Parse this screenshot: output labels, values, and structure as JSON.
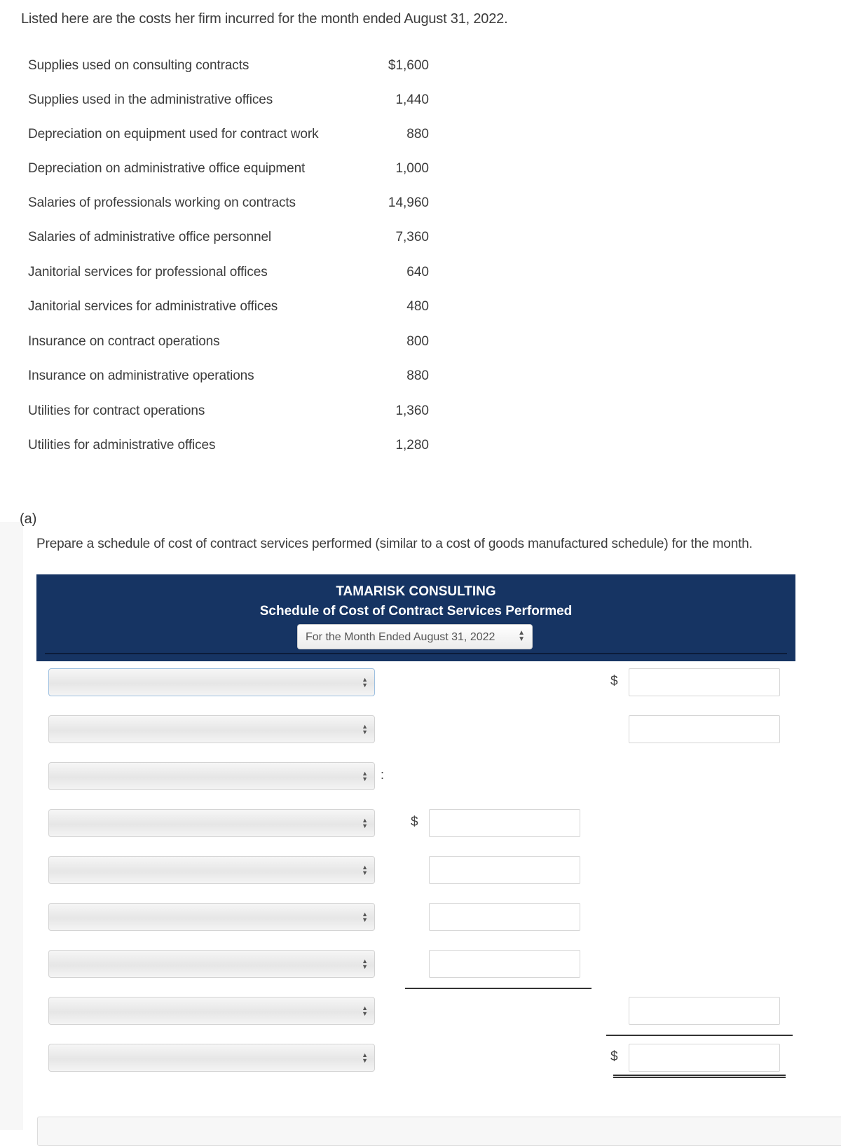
{
  "intro_text": "Listed here are the costs her firm incurred for the month ended August 31, 2022.",
  "costs": [
    {
      "label": "Supplies used on consulting contracts",
      "amount": "$1,600"
    },
    {
      "label": "Supplies used in the administrative offices",
      "amount": "1,440"
    },
    {
      "label": "Depreciation on equipment used for contract work",
      "amount": "880"
    },
    {
      "label": "Depreciation on administrative office equipment",
      "amount": "1,000"
    },
    {
      "label": "Salaries of professionals working on contracts",
      "amount": "14,960"
    },
    {
      "label": "Salaries of administrative office personnel",
      "amount": "7,360"
    },
    {
      "label": "Janitorial services for professional offices",
      "amount": "640"
    },
    {
      "label": "Janitorial services for administrative offices",
      "amount": "480"
    },
    {
      "label": "Insurance on contract operations",
      "amount": "800"
    },
    {
      "label": "Insurance on administrative operations",
      "amount": "880"
    },
    {
      "label": "Utilities for contract operations",
      "amount": "1,360"
    },
    {
      "label": "Utilities for administrative offices",
      "amount": "1,280"
    }
  ],
  "part": {
    "label": "(a)",
    "instruction": "Prepare a schedule of cost of contract services performed (similar to a cost of goods manufactured schedule) for the month."
  },
  "schedule": {
    "company": "TAMARISK CONSULTING",
    "title": "Schedule of Cost of Contract Services Performed",
    "period_selected": "For the Month Ended August 31, 2022",
    "currency_symbol": "$",
    "colon": ":",
    "rows": [
      {
        "dropdown_value": "",
        "mid_input": null,
        "right_input": ""
      },
      {
        "dropdown_value": "",
        "mid_input": null,
        "right_input": ""
      },
      {
        "dropdown_value": "",
        "mid_input": null,
        "right_input": null
      },
      {
        "dropdown_value": "",
        "mid_input": "",
        "right_input": null
      },
      {
        "dropdown_value": "",
        "mid_input": "",
        "right_input": null
      },
      {
        "dropdown_value": "",
        "mid_input": "",
        "right_input": null
      },
      {
        "dropdown_value": "",
        "mid_input": "",
        "right_input": null
      },
      {
        "dropdown_value": "",
        "mid_input": null,
        "right_input": ""
      },
      {
        "dropdown_value": "",
        "mid_input": null,
        "right_input": ""
      }
    ]
  },
  "icons": {
    "select_arrows": "▲▼"
  }
}
